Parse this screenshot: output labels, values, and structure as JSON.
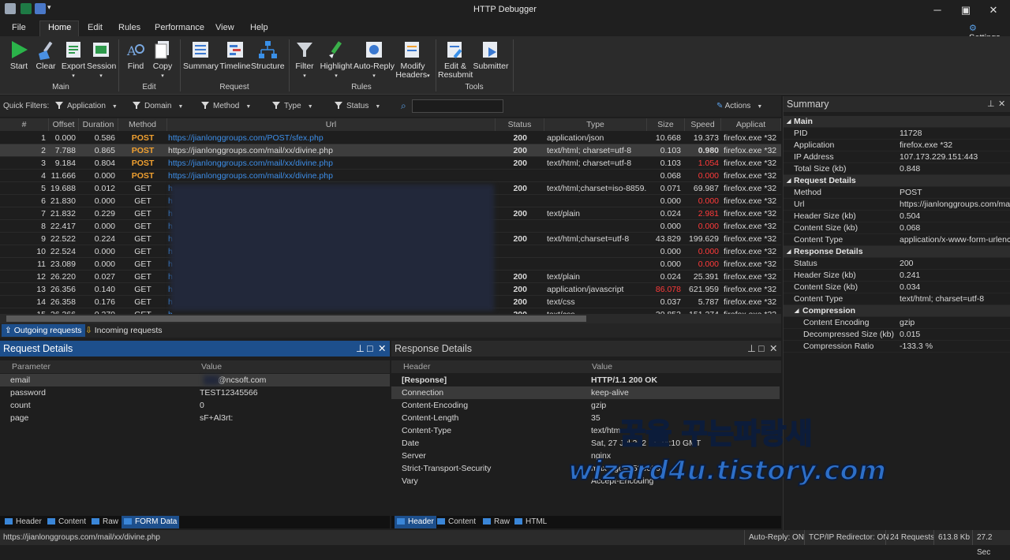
{
  "window": {
    "title": "HTTP Debugger"
  },
  "menu": [
    "File",
    "Home",
    "Edit",
    "Rules",
    "Performance",
    "View",
    "Help"
  ],
  "settings_label": "Settings",
  "ribbon": {
    "buttons": [
      {
        "label": "Start",
        "icon": "play-icon"
      },
      {
        "label": "Clear",
        "icon": "broom-icon"
      },
      {
        "label": "Export",
        "icon": "export-icon",
        "dropdown": true
      },
      {
        "label": "Session",
        "icon": "session-icon",
        "dropdown": true
      },
      {
        "label": "Find",
        "icon": "find-icon"
      },
      {
        "label": "Copy",
        "icon": "copy-icon",
        "dropdown": true
      },
      {
        "label": "Summary",
        "icon": "summary-icon"
      },
      {
        "label": "Timeline",
        "icon": "timeline-icon"
      },
      {
        "label": "Structure",
        "icon": "structure-icon"
      },
      {
        "label": "Filter",
        "icon": "filter-icon",
        "dropdown": true
      },
      {
        "label": "Highlight",
        "icon": "highlight-icon",
        "dropdown": true
      },
      {
        "label": "Auto-Reply",
        "icon": "auto-reply-icon",
        "dropdown": true
      },
      {
        "label": "Modify",
        "label2": "Headers",
        "icon": "modify-headers-icon",
        "dropdown": true
      },
      {
        "label": "Edit &",
        "label2": "Resubmit",
        "icon": "edit-resubmit-icon"
      },
      {
        "label": "Submitter",
        "icon": "submitter-icon"
      }
    ],
    "groups": [
      "Main",
      "Edit",
      "Request",
      "Rules",
      "Tools"
    ]
  },
  "quick_filters": {
    "label": "Quick Filters:",
    "items": [
      "Application",
      "Domain",
      "Method",
      "Type",
      "Status"
    ],
    "search_value": "",
    "actions": "Actions"
  },
  "grid": {
    "columns": [
      "#",
      "Offset",
      "Duration",
      "Method",
      "Url",
      "Status",
      "Type",
      "Size",
      "Speed",
      "Applicat"
    ],
    "rows": [
      {
        "n": "1",
        "offset": "0.000",
        "dur": "0.586",
        "method": "POST",
        "url": "https://jianlonggroups.com/POST/sfex.php",
        "status": "200",
        "type": "application/json",
        "size": "10.668",
        "speed": "19.373",
        "app": "firefox.exe *32"
      },
      {
        "n": "2",
        "offset": "7.788",
        "dur": "0.865",
        "method": "POST",
        "url": "https://jianlonggroups.com/mail/xx/divine.php",
        "status": "200",
        "type": "text/html; charset=utf-8",
        "size": "0.103",
        "speed": "0.980",
        "app": "firefox.exe *32"
      },
      {
        "n": "3",
        "offset": "9.184",
        "dur": "0.804",
        "method": "POST",
        "url": "https://jianlonggroups.com/mail/xx/divine.php",
        "status": "200",
        "type": "text/html; charset=utf-8",
        "size": "0.103",
        "speed": "1.054",
        "app": "firefox.exe *32"
      },
      {
        "n": "4",
        "offset": "11.666",
        "dur": "0.000",
        "method": "POST",
        "url": "https://jianlonggroups.com/mail/xx/divine.php",
        "status": "",
        "type": "",
        "size": "0.068",
        "speed": "0.000",
        "app": "firefox.exe *32"
      },
      {
        "n": "5",
        "offset": "19.688",
        "dur": "0.012",
        "method": "GET",
        "url": "h",
        "status": "200",
        "type": "text/html;charset=iso-8859...",
        "size": "0.071",
        "speed": "69.987",
        "app": "firefox.exe *32"
      },
      {
        "n": "6",
        "offset": "21.830",
        "dur": "0.000",
        "method": "GET",
        "url": "h",
        "status": "",
        "type": "",
        "size": "0.000",
        "speed": "0.000",
        "app": "firefox.exe *32"
      },
      {
        "n": "7",
        "offset": "21.832",
        "dur": "0.229",
        "method": "GET",
        "url": "h",
        "status": "200",
        "type": "text/plain",
        "size": "0.024",
        "speed": "2.981",
        "app": "firefox.exe *32"
      },
      {
        "n": "8",
        "offset": "22.417",
        "dur": "0.000",
        "method": "GET",
        "url": "h",
        "status": "",
        "type": "",
        "size": "0.000",
        "speed": "0.000",
        "app": "firefox.exe *32"
      },
      {
        "n": "9",
        "offset": "22.522",
        "dur": "0.224",
        "method": "GET",
        "url": "h",
        "status": "200",
        "type": "text/html;charset=utf-8",
        "size": "43.829",
        "speed": "199.629",
        "app": "firefox.exe *32"
      },
      {
        "n": "10",
        "offset": "22.524",
        "dur": "0.000",
        "method": "GET",
        "url": "h",
        "status": "",
        "type": "",
        "size": "0.000",
        "speed": "0.000",
        "app": "firefox.exe *32"
      },
      {
        "n": "11",
        "offset": "23.089",
        "dur": "0.000",
        "method": "GET",
        "url": "h",
        "status": "",
        "type": "",
        "size": "0.000",
        "speed": "0.000",
        "app": "firefox.exe *32"
      },
      {
        "n": "12",
        "offset": "26.220",
        "dur": "0.027",
        "method": "GET",
        "url": "h",
        "status": "200",
        "type": "text/plain",
        "size": "0.024",
        "speed": "25.391",
        "app": "firefox.exe *32"
      },
      {
        "n": "13",
        "offset": "26.356",
        "dur": "0.140",
        "method": "GET",
        "url": "h",
        "status": "200",
        "type": "application/javascript",
        "size": "86.078",
        "speed": "621.959",
        "app": "firefox.exe *32"
      },
      {
        "n": "14",
        "offset": "26.358",
        "dur": "0.176",
        "method": "GET",
        "url": "h",
        "status": "200",
        "type": "text/css",
        "size": "0.037",
        "speed": "5.787",
        "app": "firefox.exe *32"
      },
      {
        "n": "15",
        "offset": "26.366",
        "dur": "0.270",
        "method": "GET",
        "url": "h",
        "status": "200",
        "type": "text/css",
        "size": "30.853",
        "speed": "151.274",
        "app": "firefox.exe *32"
      }
    ]
  },
  "request_tabs": [
    "Outgoing requests",
    "Incoming requests"
  ],
  "request_details": {
    "title": "Request Details",
    "headers": [
      "Parameter",
      "Value"
    ],
    "rows": [
      {
        "k": "email",
        "v": "@ncsoft.com"
      },
      {
        "k": "password",
        "v": "TEST12345566"
      },
      {
        "k": "count",
        "v": "0"
      },
      {
        "k": "page",
        "v": "sF+Al3rt:"
      }
    ],
    "tabs": [
      "Header",
      "Content",
      "Raw",
      "FORM Data"
    ]
  },
  "response_details": {
    "title": "Response Details",
    "headers": [
      "Header",
      "Value"
    ],
    "rows": [
      {
        "k": "[Response]",
        "v": "HTTP/1.1 200 OK"
      },
      {
        "k": "Connection",
        "v": "keep-alive"
      },
      {
        "k": "Content-Encoding",
        "v": "gzip"
      },
      {
        "k": "Content-Length",
        "v": "35"
      },
      {
        "k": "Content-Type",
        "v": "text/htm"
      },
      {
        "k": "Date",
        "v": "Sat, 27 Jul 202  11:34:10 GMT"
      },
      {
        "k": "Server",
        "v": "nginx"
      },
      {
        "k": "Strict-Transport-Security",
        "v": "max-age=1536000"
      },
      {
        "k": "Vary",
        "v": "Accept-Encoding"
      }
    ],
    "tabs": [
      "Header",
      "Content",
      "Raw",
      "HTML"
    ]
  },
  "summary": {
    "title": "Summary",
    "sections": [
      {
        "name": "Main",
        "rows": [
          [
            "PID",
            "11728"
          ],
          [
            "Application",
            "firefox.exe *32"
          ],
          [
            "IP Address",
            "107.173.229.151:443"
          ],
          [
            "Total Size (kb)",
            "0.848"
          ]
        ]
      },
      {
        "name": "Request Details",
        "rows": [
          [
            "Method",
            "POST"
          ],
          [
            "Url",
            "https://jianlonggroups.com/mail"
          ],
          [
            "Header Size (kb)",
            "0.504"
          ],
          [
            "Content Size (kb)",
            "0.068"
          ],
          [
            "Content Type",
            "application/x-www-form-urlenco"
          ]
        ]
      },
      {
        "name": "Response Details",
        "rows": [
          [
            "Status",
            "200"
          ],
          [
            "Header Size (kb)",
            "0.241"
          ],
          [
            "Content Size (kb)",
            "0.034"
          ],
          [
            "Content Type",
            "text/html; charset=utf-8"
          ]
        ]
      },
      {
        "name": "Compression",
        "rows": [
          [
            "Content Encoding",
            "gzip"
          ],
          [
            "Decompressed Size (kb)",
            "0.015"
          ],
          [
            "Compression Ratio",
            "-133.3 %"
          ]
        ]
      }
    ]
  },
  "statusbar": {
    "url": "https://jianlonggroups.com/mail/xx/divine.php",
    "auto_reply": "Auto-Reply: ON",
    "redirector": "TCP/IP Redirector: ON",
    "requests": "24 Requests",
    "size": "613.8 Kb",
    "time": "27.2 Sec"
  },
  "watermark": {
    "line1": "꿈을 꾸는파랑새",
    "line2": "wizard4u.tistory.com"
  }
}
